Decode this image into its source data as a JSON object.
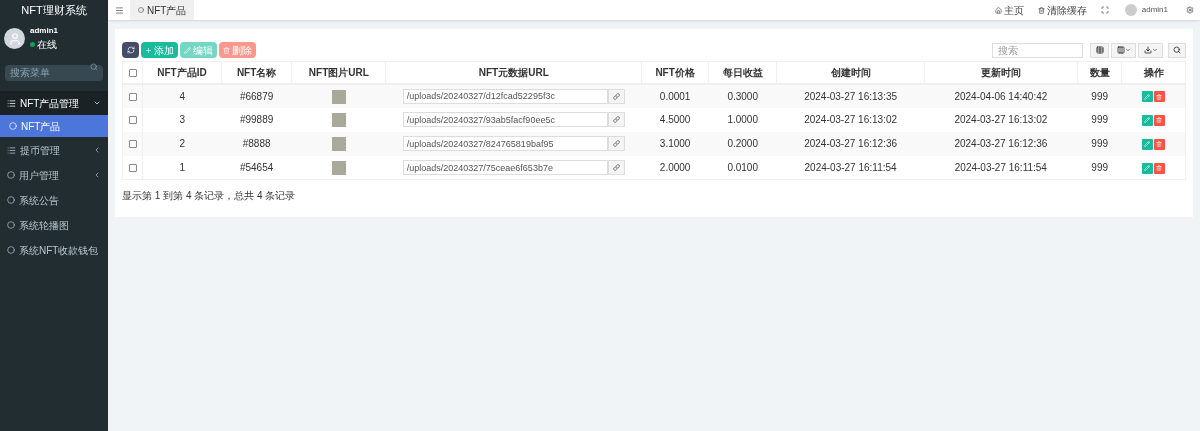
{
  "sidebar": {
    "title": "NFT理财系统",
    "user": {
      "name": "admin1",
      "status": "在线"
    },
    "search": {
      "placeholder": "搜索菜单"
    },
    "items": [
      {
        "label": "NFT产品管理",
        "kind": "group",
        "expanded": true,
        "children": [
          {
            "label": "NFT产品",
            "selected": true
          }
        ]
      },
      {
        "label": "提币管理",
        "kind": "group",
        "expanded": false
      },
      {
        "label": "用户管理",
        "kind": "page",
        "expanded": false
      },
      {
        "label": "系统公告",
        "kind": "page"
      },
      {
        "label": "系统轮播图",
        "kind": "page"
      },
      {
        "label": "系统NFT收款钱包",
        "kind": "page"
      }
    ]
  },
  "header": {
    "tabs": [
      {
        "label": "NFT产品",
        "selected": true
      }
    ],
    "links": [
      {
        "label": "主页",
        "kind": "home"
      },
      {
        "label": "清除缓存",
        "kind": "trash"
      }
    ],
    "user": "admin1"
  },
  "toolbar": {
    "buttons": [
      {
        "label": "添加",
        "kind": "add",
        "disabled": false
      },
      {
        "label": "编辑",
        "kind": "edit",
        "disabled": true
      },
      {
        "label": "删除",
        "kind": "delete",
        "disabled": true
      }
    ],
    "search": {
      "placeholder": "搜索"
    }
  },
  "table": {
    "columns": [
      "NFT产品ID",
      "NFT名称",
      "NFT图片URL",
      "NFT元数据URL",
      "NFT价格",
      "每日收益",
      "创建时间",
      "更新时间",
      "数量",
      "操作"
    ],
    "all_checked": false,
    "rows": [
      {
        "checked": false,
        "id": "4",
        "name": "#66879",
        "metadata": "/uploads/20240327/d12fcad52295f3c",
        "price": "0.0001",
        "daily": "0.3000",
        "created": "2024-03-27 16:13:35",
        "updated": "2024-04-06 14:40:42",
        "qty": "999"
      },
      {
        "checked": false,
        "id": "3",
        "name": "#99889",
        "metadata": "/uploads/20240327/93ab5facf90ee5c",
        "price": "4.5000",
        "daily": "1.0000",
        "created": "2024-03-27 16:13:02",
        "updated": "2024-03-27 16:13:02",
        "qty": "999"
      },
      {
        "checked": false,
        "id": "2",
        "name": "#8888",
        "metadata": "/uploads/20240327/824765819baf95",
        "price": "3.1000",
        "daily": "0.2000",
        "created": "2024-03-27 16:12:36",
        "updated": "2024-03-27 16:12:36",
        "qty": "999"
      },
      {
        "checked": false,
        "id": "1",
        "name": "#54654",
        "metadata": "/uploads/20240327/75ceae6f653b7e",
        "price": "2.0000",
        "daily": "0.0100",
        "created": "2024-03-27 16:11:54",
        "updated": "2024-03-27 16:11:54",
        "qty": "999"
      }
    ],
    "footer": "显示第 1 到第 4 条记录，总共 4 条记录"
  }
}
